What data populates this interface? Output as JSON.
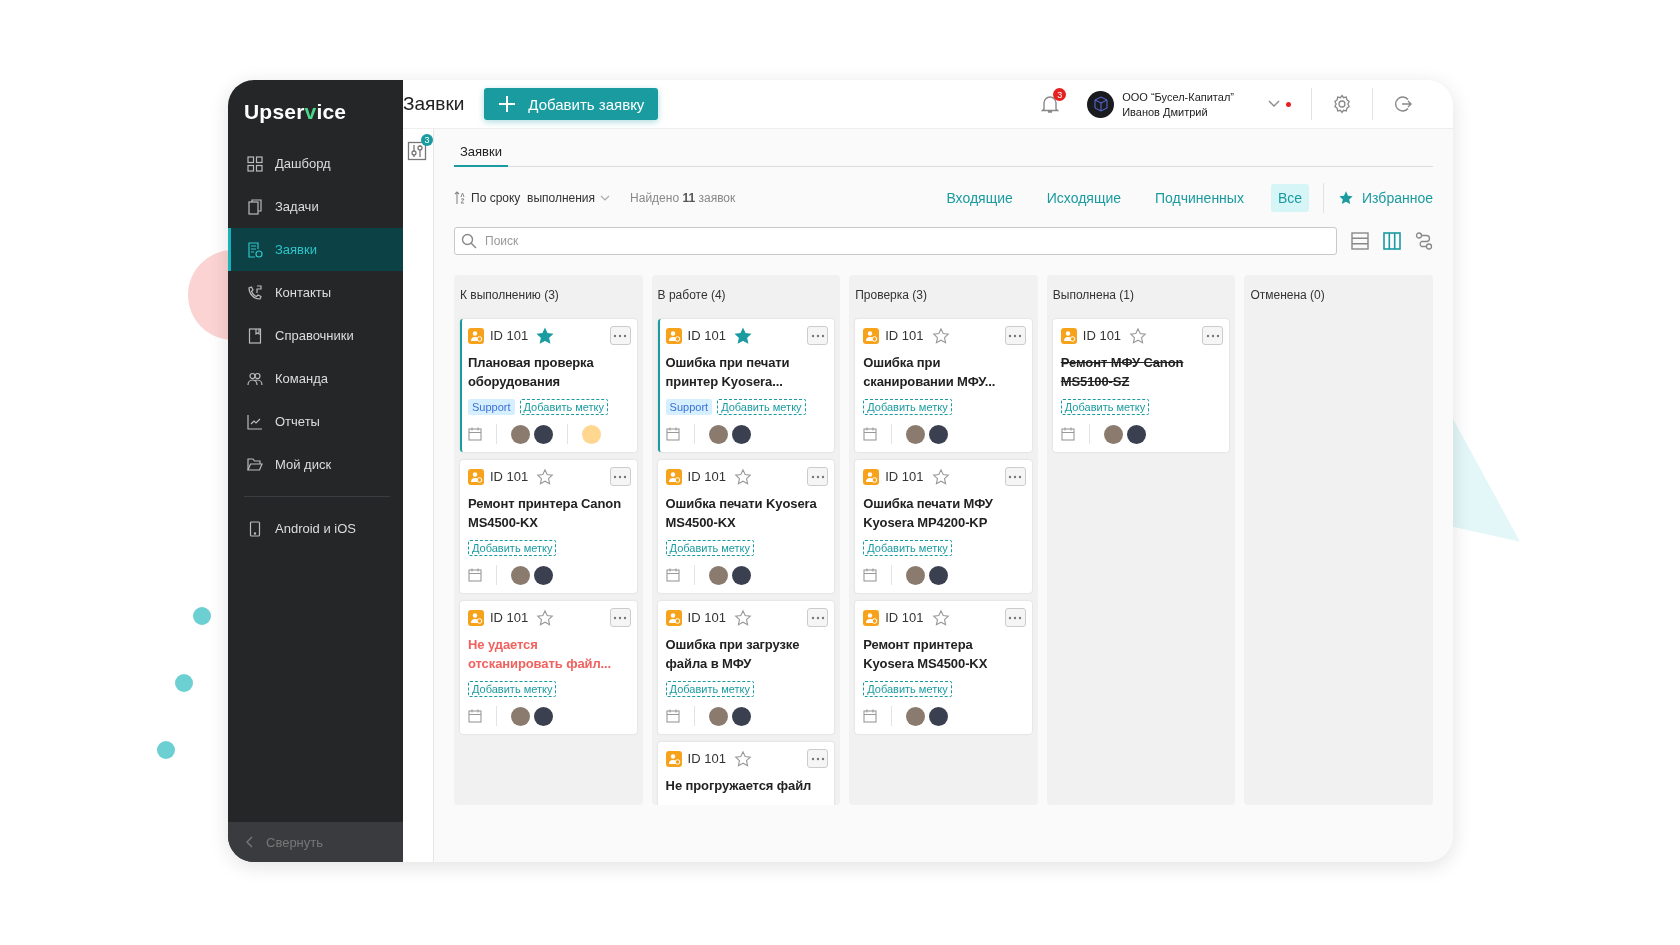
{
  "logo": {
    "prefix": "Upser",
    "check": "v",
    "suffix": "ice"
  },
  "sidebar": {
    "items": [
      {
        "label": "Дашборд",
        "selected": false
      },
      {
        "label": "Задачи",
        "selected": false
      },
      {
        "label": "Заявки",
        "selected": true
      },
      {
        "label": "Контакты",
        "selected": false
      },
      {
        "label": "Справочники",
        "selected": false
      },
      {
        "label": "Команда",
        "selected": false
      },
      {
        "label": "Отчеты",
        "selected": false
      },
      {
        "label": "Мой диск",
        "selected": false
      }
    ],
    "extra_items": [
      {
        "label": "Android и iOS",
        "selected": false
      }
    ],
    "collapse": "Свернуть"
  },
  "header": {
    "title": "Заявки",
    "add_button": "Добавить заявку",
    "notifications": "3",
    "org": "ООО “Бусел-Капитал”",
    "user": "Иванов Дмитрий",
    "online": true
  },
  "filter_badge": "3",
  "tabs": [
    {
      "label": "Заявки",
      "selected": true
    }
  ],
  "toolbar": {
    "sort": "По сроку  выполнения",
    "found": "Найдено **11** заявок",
    "filters": [
      {
        "label": "Входящие",
        "selected": false
      },
      {
        "label": "Исходящие",
        "selected": false
      },
      {
        "label": "Подчиненных",
        "selected": false
      },
      {
        "label": "Все",
        "selected": true
      }
    ],
    "favorites": "Избранное"
  },
  "search": {
    "placeholder": "Поиск"
  },
  "views": [
    {
      "kind": "list",
      "selected": false
    },
    {
      "kind": "board",
      "selected": true
    },
    {
      "kind": "flow",
      "selected": false
    }
  ],
  "columns": [
    {
      "title": "К выполнению (3)",
      "cards": [
        {
          "id": "ID 101",
          "starred": true,
          "highlighted": true,
          "overdue": false,
          "done": false,
          "title": "Плановая проверка оборудования",
          "tags": [
            "Support"
          ],
          "add_tag": "Добавить метку",
          "watcher": true
        },
        {
          "id": "ID 101",
          "starred": false,
          "highlighted": false,
          "overdue": false,
          "done": false,
          "title": "Ремонт принтера Canon MS4500-KX",
          "add_tag": "Добавить метку",
          "watcher": false
        },
        {
          "id": "ID 101",
          "starred": false,
          "highlighted": false,
          "overdue": true,
          "done": false,
          "title": "Не удается отсканировать файл...",
          "add_tag": "Добавить метку",
          "watcher": false
        }
      ]
    },
    {
      "title": "В работе (4)",
      "cards": [
        {
          "id": "ID 101",
          "starred": true,
          "highlighted": true,
          "overdue": false,
          "done": false,
          "title": "Ошибка при печати принтер Kyosera...",
          "tags": [
            "Support"
          ],
          "add_tag": "Добавить метку",
          "watcher": false
        },
        {
          "id": "ID 101",
          "starred": false,
          "highlighted": false,
          "overdue": false,
          "done": false,
          "title": "Ошибка печати Kyosera MS4500-KX",
          "add_tag": "Добавить метку",
          "watcher": false
        },
        {
          "id": "ID 101",
          "starred": false,
          "highlighted": false,
          "overdue": false,
          "done": false,
          "title": "Ошибка при загрузке файла в МФУ",
          "add_tag": "Добавить метку",
          "watcher": false
        },
        {
          "id": "ID 101",
          "starred": false,
          "highlighted": false,
          "overdue": false,
          "done": false,
          "title": "Не прогружается файл"
        }
      ]
    },
    {
      "title": "Проверка (3)",
      "cards": [
        {
          "id": "ID 101",
          "starred": false,
          "highlighted": false,
          "overdue": false,
          "done": false,
          "title": "Ошибка при сканировании МФУ...",
          "add_tag": "Добавить метку",
          "watcher": false
        },
        {
          "id": "ID 101",
          "starred": false,
          "highlighted": false,
          "overdue": false,
          "done": false,
          "title": "Ошибка печати МФУ Kyosera MP4200-KP",
          "add_tag": "Добавить метку",
          "watcher": false
        },
        {
          "id": "ID 101",
          "starred": false,
          "highlighted": false,
          "overdue": false,
          "done": false,
          "title": "Ремонт принтера Kyosera MS4500-KX",
          "add_tag": "Добавить метку",
          "watcher": false
        }
      ]
    },
    {
      "title": "Выполнена (1)",
      "cards": [
        {
          "id": "ID 101",
          "starred": false,
          "highlighted": false,
          "overdue": false,
          "done": true,
          "title": "Ремонт МФУ Canon MS5100-SZ",
          "add_tag": "Добавить метку",
          "watcher": false
        }
      ]
    },
    {
      "title": "Отменена (0)"
    }
  ]
}
